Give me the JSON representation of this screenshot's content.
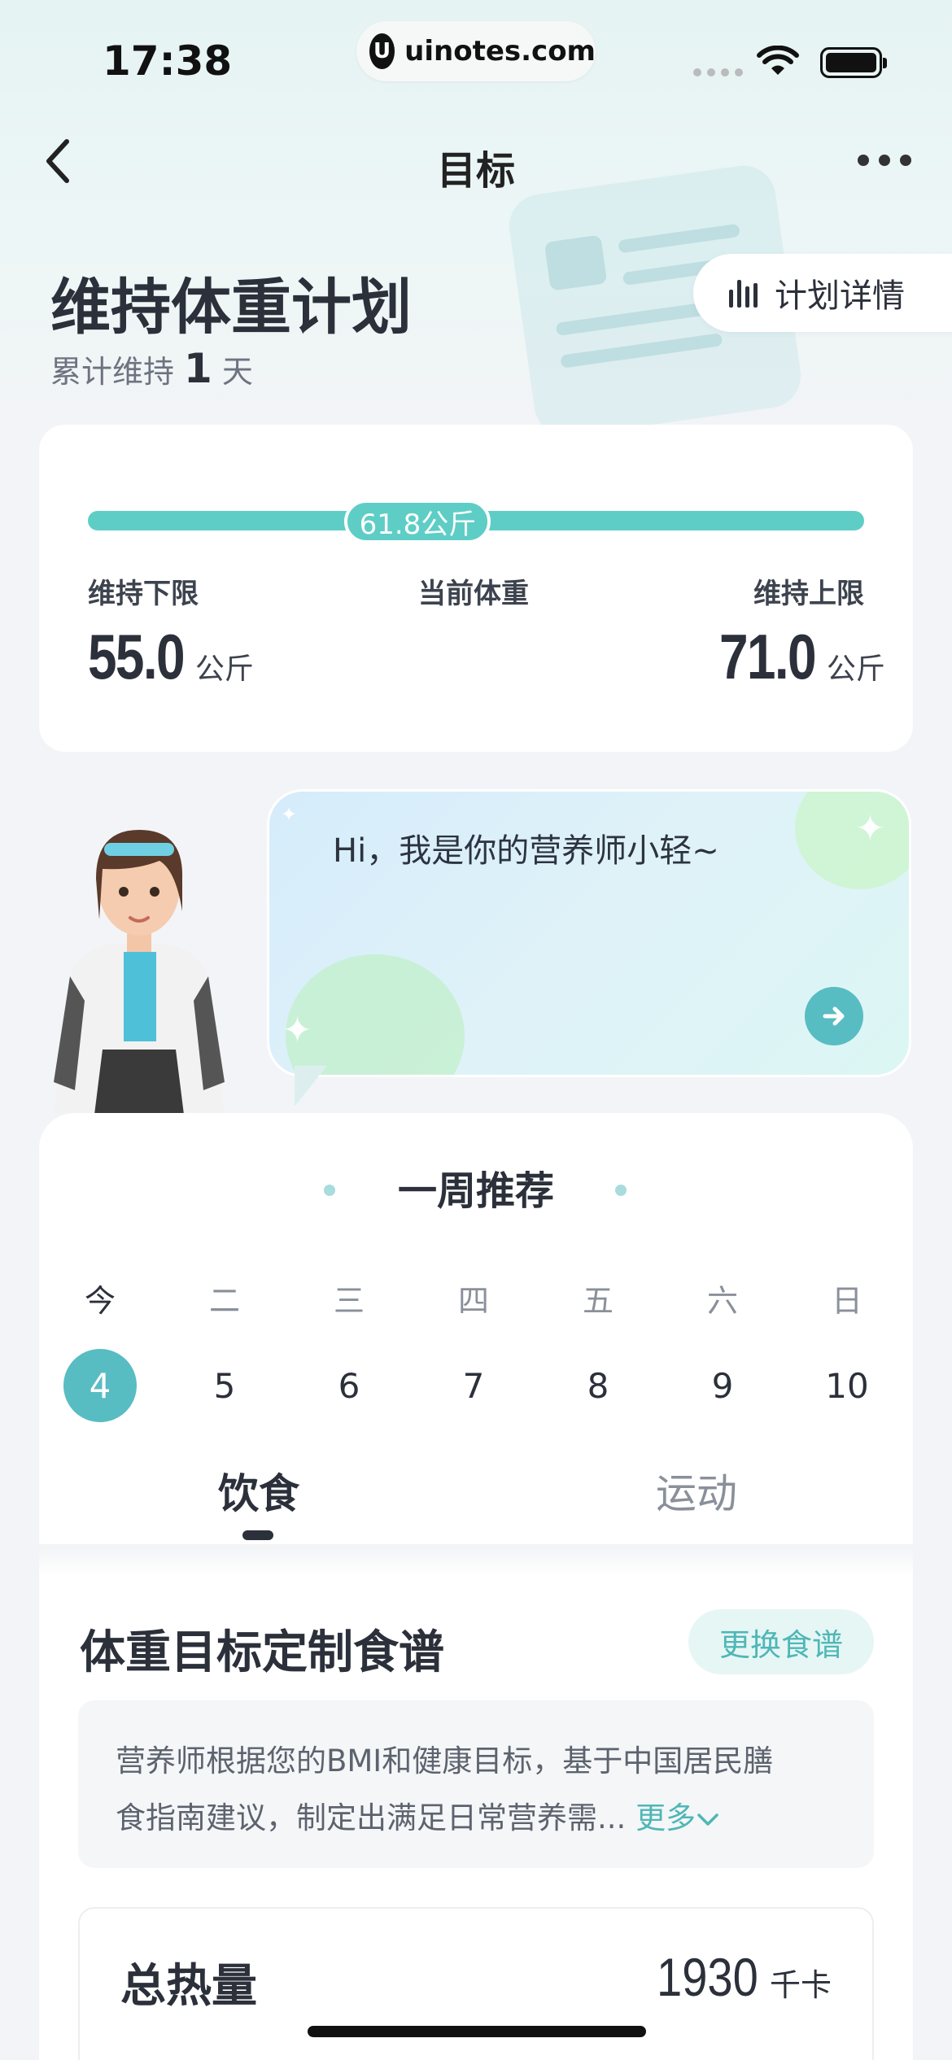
{
  "status_bar": {
    "time": "17:38",
    "url": "uinotes.com"
  },
  "nav": {
    "title": "目标"
  },
  "plan": {
    "title": "维持体重计划",
    "days_prefix": "累计维持",
    "days_value": "1",
    "days_suffix": "天",
    "detail_label": "计划详情"
  },
  "weight": {
    "current_value": "61.8公斤",
    "lower_label": "维持下限",
    "current_label": "当前体重",
    "upper_label": "维持上限",
    "lower_value": "55.0",
    "upper_value": "71.0",
    "unit": "公斤",
    "position_fraction": 0.425
  },
  "assistant": {
    "greeting": "Hi，我是你的营养师小轻~"
  },
  "weekly": {
    "title": "一周推荐",
    "days": [
      {
        "weekday": "今",
        "date": "4",
        "active": true
      },
      {
        "weekday": "二",
        "date": "5",
        "active": false
      },
      {
        "weekday": "三",
        "date": "6",
        "active": false
      },
      {
        "weekday": "四",
        "date": "7",
        "active": false
      },
      {
        "weekday": "五",
        "date": "8",
        "active": false
      },
      {
        "weekday": "六",
        "date": "9",
        "active": false
      },
      {
        "weekday": "日",
        "date": "10",
        "active": false
      }
    ],
    "tabs": {
      "diet": "饮食",
      "exercise": "运动"
    }
  },
  "diet": {
    "title": "体重目标定制食谱",
    "change_button": "更换食谱",
    "description_line1": "营养师根据您的BMI和健康目标，基于中国居民膳",
    "description_line2": "食指南建议，制定出满足日常营养需...",
    "more_label": "更多",
    "total_calories_label": "总热量",
    "total_calories_value": "1930",
    "total_calories_unit": "千卡"
  },
  "colors": {
    "accent": "#58bcc3",
    "bar": "#5ecdc6",
    "link": "#4fb7b6"
  }
}
